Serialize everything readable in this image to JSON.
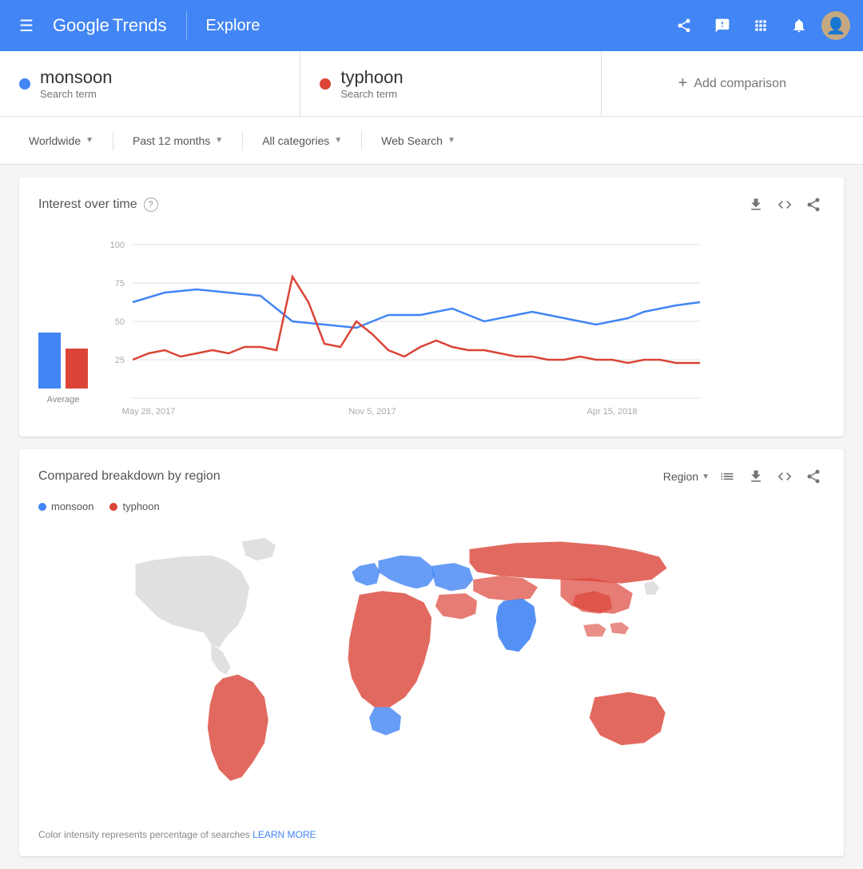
{
  "header": {
    "logo_google": "Google",
    "logo_trends": "Trends",
    "explore_label": "Explore",
    "share_icon": "share",
    "feedback_icon": "feedback",
    "apps_icon": "apps",
    "notifications_icon": "notifications"
  },
  "search_terms": [
    {
      "id": "monsoon",
      "name": "monsoon",
      "type": "Search term",
      "color": "#4285f4"
    },
    {
      "id": "typhoon",
      "name": "typhoon",
      "type": "Search term",
      "color": "#db4437"
    }
  ],
  "add_comparison_label": "Add comparison",
  "filters": {
    "location": "Worldwide",
    "time_range": "Past 12 months",
    "categories": "All categories",
    "search_type": "Web Search"
  },
  "interest_chart": {
    "title": "Interest over time",
    "help_icon": "?",
    "average_label": "Average",
    "x_labels": [
      "May 28, 2017",
      "Nov 5, 2017",
      "Apr 15, 2018"
    ],
    "y_labels": [
      "100",
      "75",
      "50",
      "25"
    ],
    "download_icon": "download",
    "embed_icon": "embed",
    "share_icon": "share"
  },
  "region_chart": {
    "title": "Compared breakdown by region",
    "region_label": "Region",
    "legend": [
      {
        "term": "monsoon",
        "color": "#4285f4"
      },
      {
        "term": "typhoon",
        "color": "#db4437"
      }
    ],
    "footer_text": "Color intensity represents percentage of searches",
    "learn_more": "LEARN MORE",
    "download_icon": "download",
    "embed_icon": "embed",
    "share_icon": "share"
  }
}
